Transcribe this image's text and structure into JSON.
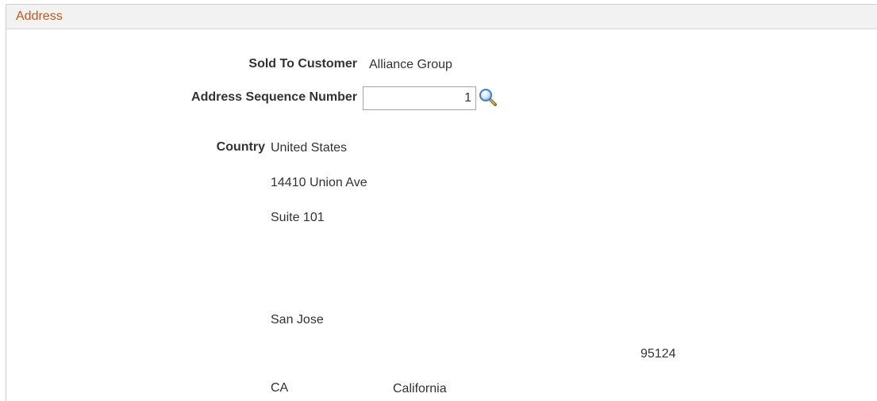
{
  "section": {
    "title": "Address"
  },
  "form": {
    "sold_to_customer": {
      "label": "Sold To Customer",
      "value": "Alliance Group"
    },
    "address_sequence": {
      "label": "Address Sequence Number",
      "value": "1"
    },
    "country": {
      "label": "Country",
      "value": "United States"
    },
    "address": {
      "line1": "14410 Union Ave",
      "line2": "Suite 101",
      "city": "San Jose",
      "postal": "95124",
      "state_code": "CA",
      "state_name": "California"
    }
  },
  "icons": {
    "lookup": "magnifier-lookup-icon"
  },
  "colors": {
    "section_title": "#c15a1b",
    "header_bg": "#f2f2f2",
    "lookup_icon": "#3c7fc4"
  }
}
